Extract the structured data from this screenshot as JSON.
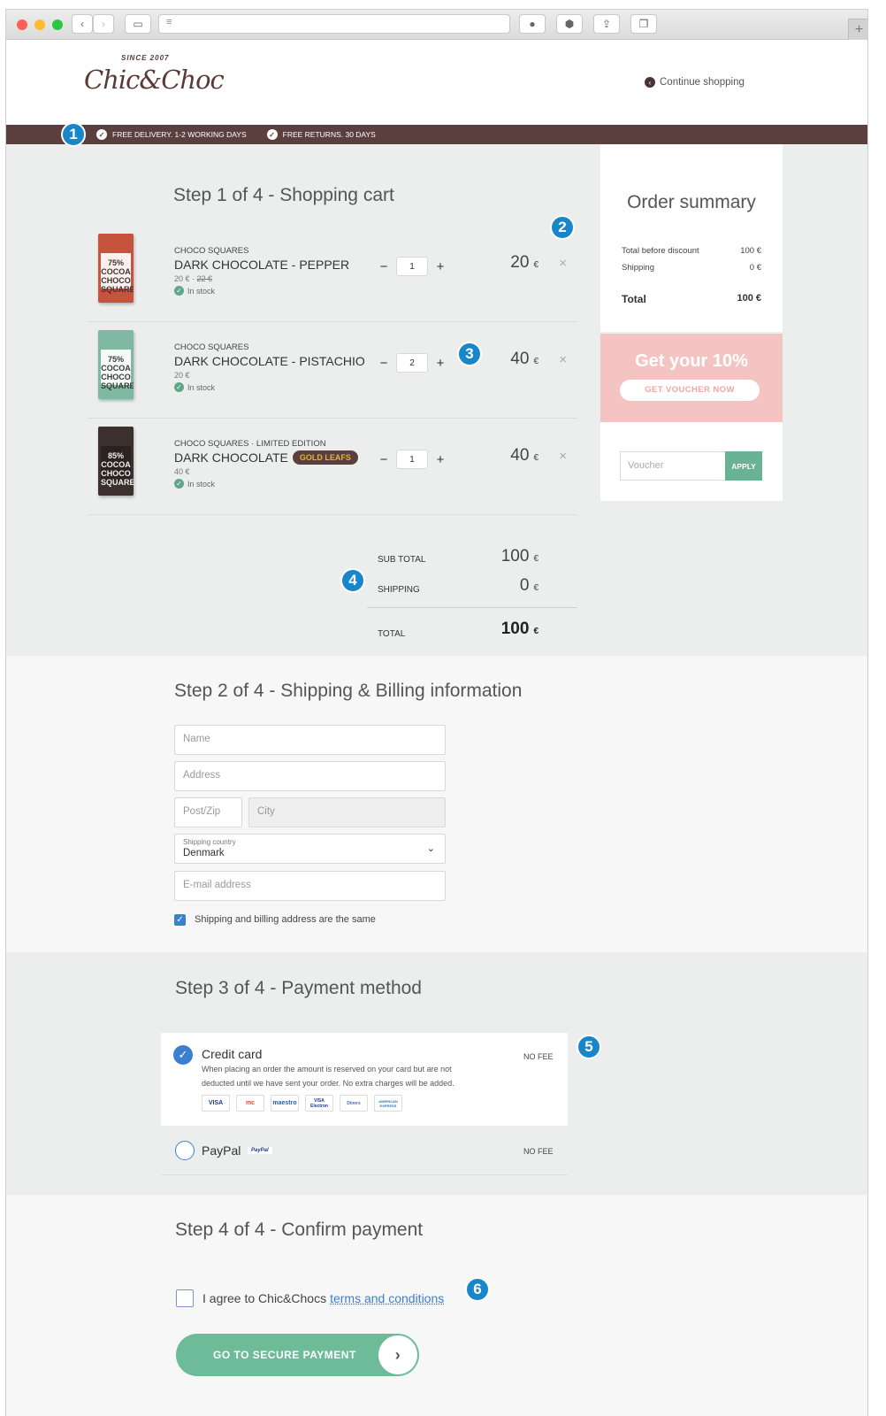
{
  "browser": {
    "title_bar_buttons": [
      "back-icon",
      "forward-icon",
      "sidebar-icon"
    ],
    "toolbar_icons": [
      "shield-icon",
      "extension-icon",
      "share-icon",
      "tabs-icon"
    ],
    "new_tab": "+"
  },
  "header": {
    "logo_since": "SINCE 2007",
    "logo_text": "Chic&Choc",
    "continue_label": "Continue shopping"
  },
  "promo_bar": {
    "items": [
      "FREE DELIVERY. 1-2 WORKING DAYS",
      "FREE RETURNS. 30 DAYS"
    ]
  },
  "badges": [
    "1",
    "2",
    "3",
    "4",
    "5",
    "6"
  ],
  "step1": {
    "title": "Step 1 of 4 - Shopping cart",
    "items": [
      {
        "brand": "CHOCO SQUARES",
        "name": "DARK CHOCOLATE - PEPPER",
        "price": "20 €",
        "old_price": "22 €",
        "stock": "In stock",
        "qty": "1",
        "line_price": "20",
        "currency": "€",
        "img_text": "75% COCOA CHOCO SQUARES",
        "img_color": "#c6533d"
      },
      {
        "brand": "CHOCO SQUARES",
        "name": "DARK CHOCOLATE - PISTACHIO",
        "price": "20 €",
        "old_price": "",
        "stock": "In stock",
        "qty": "2",
        "line_price": "40",
        "currency": "€",
        "img_text": "75% COCOA CHOCO SQUARES",
        "img_color": "#7fb9a3"
      },
      {
        "brand": "CHOCO SQUARES",
        "brand_suffix": "LIMITED EDITION",
        "name": "DARK CHOCOLATE",
        "tag": "GOLD LEAFS",
        "price": "40 €",
        "old_price": "",
        "stock": "In stock",
        "qty": "1",
        "line_price": "40",
        "currency": "€",
        "img_text": "85% COCOA CHOCO SQUARES",
        "img_color": "#3b302e"
      }
    ],
    "qty_minus": "−",
    "qty_plus": "+",
    "remove": "×",
    "subtotal_label": "SUB TOTAL",
    "subtotal_value": "100",
    "shipping_label": "SHIPPING",
    "shipping_value": "0",
    "total_label": "TOTAL",
    "total_value": "100",
    "currency": "€"
  },
  "summary": {
    "title": "Order summary",
    "rows": [
      {
        "label": "Total before discount",
        "value": "100 €"
      },
      {
        "label": "Shipping",
        "value": "0 €"
      }
    ],
    "total_label": "Total",
    "total_value": "100 €",
    "promo_title": "Get your 10%",
    "promo_button": "GET VOUCHER NOW",
    "voucher_placeholder": "Voucher",
    "apply_label": "APPLY"
  },
  "step2": {
    "title": "Step 2 of 4 - Shipping & Billing information",
    "name_placeholder": "Name",
    "address_placeholder": "Address",
    "zip_placeholder": "Post/Zip",
    "city_placeholder": "City",
    "country_label": "Shipping country",
    "country_value": "Denmark",
    "email_placeholder": "E-mail address",
    "same_address_label": "Shipping and billing address are the same"
  },
  "step3": {
    "title": "Step 3 of 4 -  Payment method",
    "credit_card_label": "Credit card",
    "credit_card_fee": "NO FEE",
    "credit_card_desc_1": "When placing an order the amount is reserved on your card but are not",
    "credit_card_desc_2": "deducted until we have sent your order. No extra charges will be added.",
    "card_logos": [
      "VISA",
      "mc",
      "maestro",
      "VISA Electron",
      "Diners",
      "AMERICAN EXPRESS"
    ],
    "paypal_label": "PayPal",
    "paypal_logo": "PayPal",
    "paypal_fee": "NO FEE"
  },
  "step4": {
    "title": "Step 4 of 4 -  Confirm payment",
    "agree_text": "I agree to Chic&Chocs",
    "terms_link": "terms and conditions",
    "pay_button": "GO TO SECURE PAYMENT",
    "pay_arrow": "›"
  },
  "colors": {
    "brand_brown": "#5a3f3e",
    "accent_green": "#69b295",
    "badge_blue": "#1886c9",
    "promo_pink": "#f4c4c3",
    "check_blue": "#3b7fd1"
  }
}
